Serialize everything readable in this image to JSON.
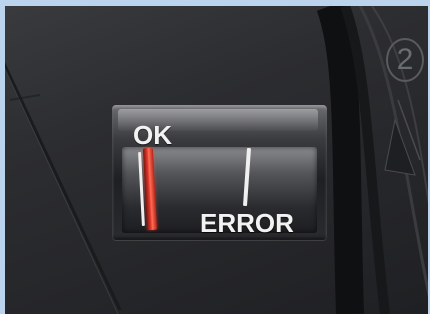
{
  "indicator": {
    "ok_label": "OK",
    "error_label": "ERROR",
    "state": "OK"
  },
  "housing": {
    "number_marking": "2"
  },
  "colors": {
    "housing": "#2c2d30",
    "needle": "#e23a2c",
    "label_text": "#f2f2f2",
    "frame_border": "#bcd3ee"
  }
}
